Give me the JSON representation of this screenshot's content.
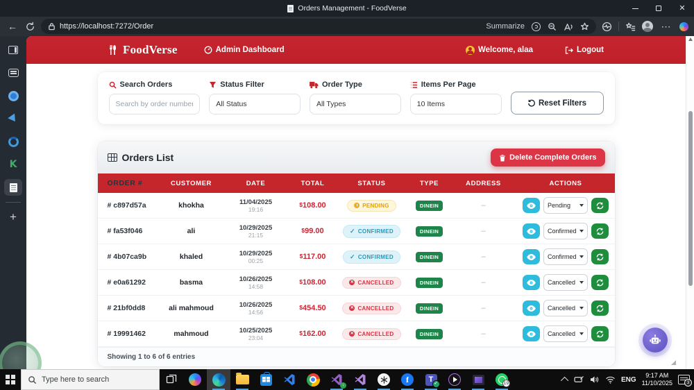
{
  "browser": {
    "tab_title": "Orders Management - FoodVerse",
    "url": "https://localhost:7272/Order",
    "summarize_label": "Summarize"
  },
  "header": {
    "brand": "FoodVerse",
    "nav_dashboard": "Admin Dashboard",
    "welcome": "Welcome, alaa",
    "logout": "Logout"
  },
  "filters": {
    "search": {
      "label": "Search Orders",
      "placeholder": "Search by order number, cu"
    },
    "status": {
      "label": "Status Filter",
      "value": "All Status"
    },
    "type": {
      "label": "Order Type",
      "value": "All Types"
    },
    "per_page": {
      "label": "Items Per Page",
      "value": "10 Items"
    },
    "reset_label": "Reset Filters"
  },
  "orders": {
    "title": "Orders List",
    "delete_button": "Delete Complete Orders",
    "columns": {
      "id": "ORDER #",
      "customer": "CUSTOMER",
      "date": "DATE",
      "total": "TOTAL",
      "status": "STATUS",
      "type": "TYPE",
      "address": "ADDRESS",
      "actions": "ACTIONS"
    },
    "rows": [
      {
        "id": "# c897d57a",
        "customer": "khokha",
        "date": "11/04/2025",
        "time": "19:16",
        "currency": "$",
        "total": "108.00",
        "status": "PENDING",
        "status_kind": "pending",
        "type": "DINEIN",
        "address": "–",
        "action_status": "Pending"
      },
      {
        "id": "# fa53f046",
        "customer": "ali",
        "date": "10/29/2025",
        "time": "21:15",
        "currency": "$",
        "total": "99.00",
        "status": "CONFIRMED",
        "status_kind": "confirmed",
        "type": "DINEIN",
        "address": "–",
        "action_status": "Confirmed"
      },
      {
        "id": "# 4b07ca9b",
        "customer": "khaled",
        "date": "10/29/2025",
        "time": "00:25",
        "currency": "$",
        "total": "117.00",
        "status": "CONFIRMED",
        "status_kind": "confirmed",
        "type": "DINEIN",
        "address": "–",
        "action_status": "Confirmed"
      },
      {
        "id": "# e0a61292",
        "customer": "basma",
        "date": "10/26/2025",
        "time": "14:58",
        "currency": "$",
        "total": "108.00",
        "status": "CANCELLED",
        "status_kind": "cancelled",
        "type": "DINEIN",
        "address": "–",
        "action_status": "Cancelled"
      },
      {
        "id": "# 21bf0dd8",
        "customer": "ali mahmoud",
        "date": "10/26/2025",
        "time": "14:56",
        "currency": "$",
        "total": "454.50",
        "status": "CANCELLED",
        "status_kind": "cancelled",
        "type": "DINEIN",
        "address": "–",
        "action_status": "Cancelled"
      },
      {
        "id": "# 19991462",
        "customer": "mahmoud",
        "date": "10/25/2025",
        "time": "23:04",
        "currency": "$",
        "total": "162.00",
        "status": "CANCELLED",
        "status_kind": "cancelled",
        "type": "DINEIN",
        "address": "–",
        "action_status": "Cancelled"
      }
    ],
    "footer": "Showing 1 to 6 of 6 entries"
  },
  "taskbar": {
    "search_placeholder": "Type here to search",
    "language": "ENG",
    "time": "9:17 AM",
    "date": "11/10/2025",
    "notification_count": "3",
    "whatsapp_badge": "19"
  },
  "colors": {
    "brand_red": "#c4262c",
    "danger": "#dc3545",
    "success_green": "#1e8449",
    "info_cyan": "#2ebbdc",
    "pending_yellow": "#efad23"
  }
}
